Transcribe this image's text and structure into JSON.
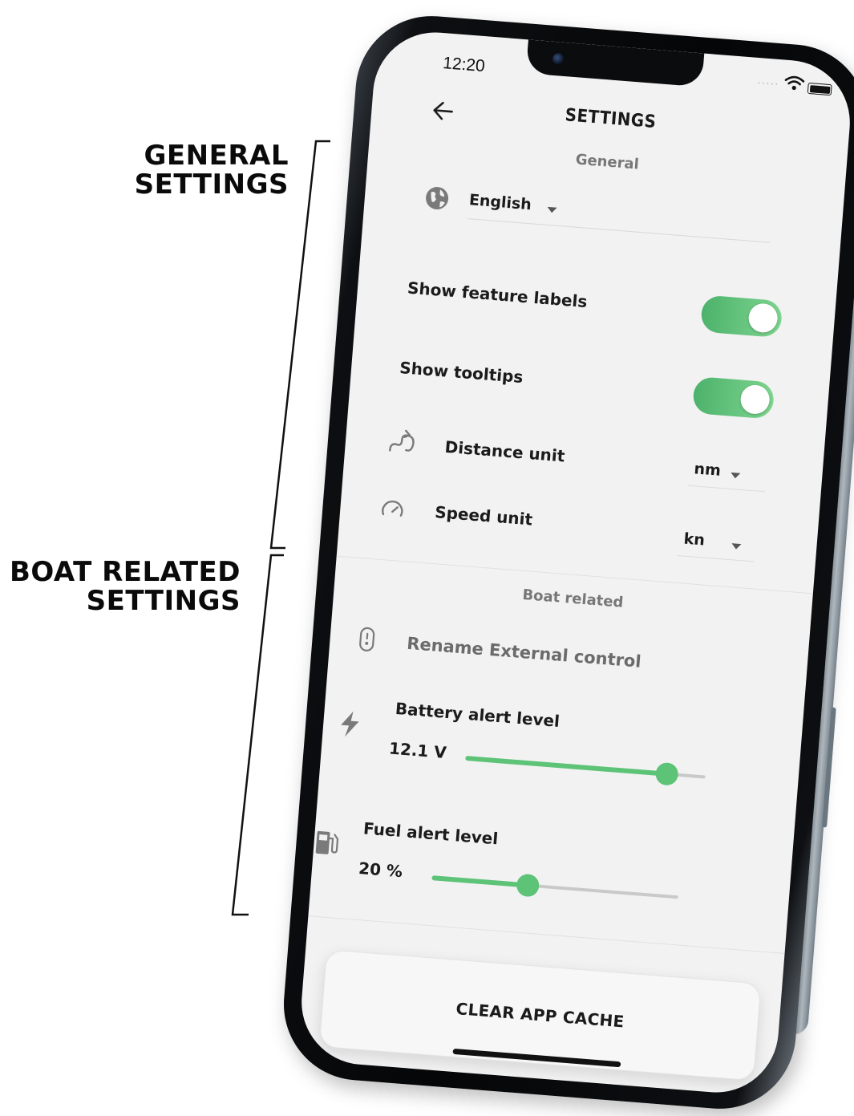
{
  "annotations": {
    "general": [
      "GENERAL",
      "SETTINGS"
    ],
    "boat": [
      "BOAT RELATED",
      "SETTINGS"
    ]
  },
  "status_bar": {
    "time": "12:20",
    "signal_dots": "....."
  },
  "header": {
    "title": "SETTINGS",
    "back_icon": "arrow-left-icon"
  },
  "general": {
    "section_title": "General",
    "language": {
      "icon": "globe-icon",
      "value": "English"
    },
    "show_feature_labels": {
      "label": "Show feature labels",
      "on": true
    },
    "show_tooltips": {
      "label": "Show tooltips",
      "on": true
    },
    "distance_unit": {
      "icon": "route-icon",
      "label": "Distance unit",
      "value": "nm"
    },
    "speed_unit": {
      "icon": "speedometer-icon",
      "label": "Speed unit",
      "value": "kn"
    }
  },
  "boat": {
    "section_title": "Boat related",
    "rename": {
      "icon": "remote-control-icon",
      "label": "Rename External control"
    },
    "battery": {
      "icon": "lightning-icon",
      "label": "Battery alert level",
      "value": "12.1 V",
      "fraction": 0.84
    },
    "fuel": {
      "icon": "fuel-pump-icon",
      "label": "Fuel alert level",
      "value": "20 %",
      "fraction": 0.39
    }
  },
  "actions": {
    "clear_cache_label": "CLEAR APP CACHE"
  },
  "colors": {
    "accent": "#5cc377",
    "toggle_start": "#4cb26b",
    "toggle_end": "#7ed58f",
    "screen_bg": "#f2f2f2"
  }
}
